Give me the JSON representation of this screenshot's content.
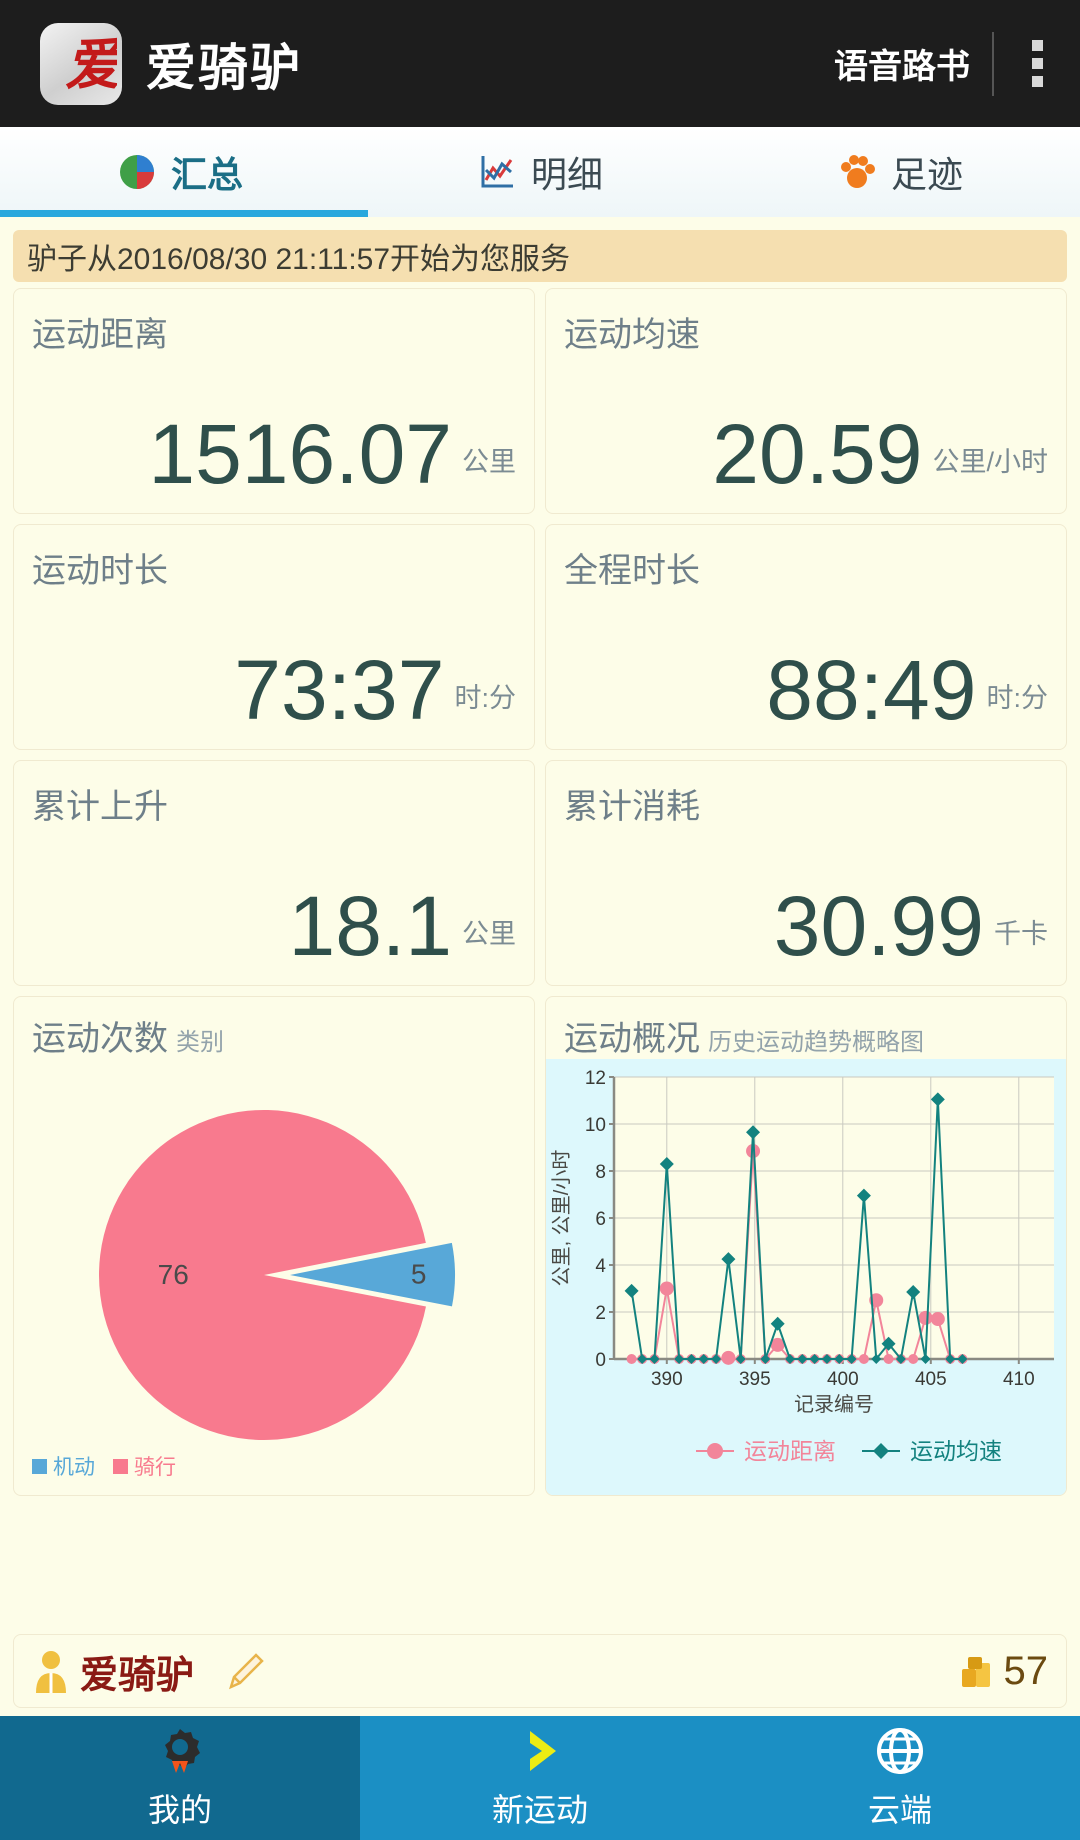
{
  "appbar": {
    "logo_icon": "app-logo-icon",
    "title": "爱骑驴",
    "voice_button": "语音路书",
    "overflow_icon": "overflow-menu-icon"
  },
  "tabs": [
    {
      "label": "汇总",
      "icon": "pie-chart-icon",
      "active": true
    },
    {
      "label": "明细",
      "icon": "line-chart-icon",
      "active": false
    },
    {
      "label": "足迹",
      "icon": "paw-print-icon",
      "active": false
    }
  ],
  "banner": {
    "text": "驴子从2016/08/30 21:11:57开始为您服务"
  },
  "stats": [
    {
      "title": "运动距离",
      "value": "1516.07",
      "unit": "公里"
    },
    {
      "title": "运动均速",
      "value": "20.59",
      "unit": "公里/小时"
    },
    {
      "title": "运动时长",
      "value": "73:37",
      "unit": "时:分"
    },
    {
      "title": "全程时长",
      "value": "88:49",
      "unit": "时:分"
    },
    {
      "title": "累计上升",
      "value": "18.1",
      "unit": "公里"
    },
    {
      "title": "累计消耗",
      "value": "30.99",
      "unit": "千卡"
    }
  ],
  "pie_card": {
    "title": "运动次数",
    "subtitle": "类别"
  },
  "line_card": {
    "title": "运动概况",
    "subtitle": "历史运动趋势概略图"
  },
  "userbar": {
    "avatar_icon": "user-avatar-icon",
    "name": "爱骑驴",
    "edit_icon": "pencil-edit-icon",
    "coin_icon": "coin-stack-icon",
    "coin_count": "57"
  },
  "bottomnav": [
    {
      "label": "我的",
      "icon": "gear-rocket-icon",
      "active": true
    },
    {
      "label": "新运动",
      "icon": "chevron-right-icon",
      "active": false
    },
    {
      "label": "云端",
      "icon": "globe-icon",
      "active": false
    }
  ],
  "colors": {
    "accent": "#29a8dd",
    "nav": "#1b8fc4",
    "nav_active": "#11698f",
    "card_bg": "#fdfde8",
    "banner_bg": "#f5dfb0",
    "pie_pink": "#f87a8e",
    "pie_blue": "#58a8d8",
    "line_pink": "#f2859a",
    "line_teal": "#13827f",
    "chart_bg": "#ddf8fc",
    "value_text": "#2f4f4b",
    "title_text": "#6e7f89"
  },
  "chart_data": [
    {
      "type": "pie",
      "title": "运动次数",
      "subtitle": "类别",
      "labels": [
        "骑行",
        "机动"
      ],
      "values": [
        76,
        5
      ],
      "colors": [
        "#f87a8e",
        "#58a8d8"
      ],
      "exploded": [
        "机动"
      ],
      "legend_position": "bottom-left",
      "data_labels": [
        "76",
        "5"
      ]
    },
    {
      "type": "line",
      "title": "运动概况",
      "subtitle": "历史运动趋势概略图",
      "xlabel": "记录编号",
      "ylabel": "公里, 公里/小时",
      "xlim": [
        387,
        412
      ],
      "ylim": [
        0,
        12
      ],
      "xticks": [
        390,
        395,
        400,
        405,
        410
      ],
      "yticks": [
        0,
        2,
        4,
        6,
        8,
        10,
        12
      ],
      "grid": true,
      "legend_position": "bottom-center",
      "x": [
        388,
        388.6,
        389.3,
        390,
        390.7,
        391.4,
        392.1,
        392.8,
        393.5,
        394.2,
        394.9,
        395.6,
        396.3,
        397,
        397.7,
        398.4,
        399.1,
        399.8,
        400.5,
        401.2,
        401.9,
        402.6,
        403.3,
        404,
        404.7,
        405.4,
        406.1,
        406.8
      ],
      "series": [
        {
          "name": "运动距离",
          "color": "#f2859a",
          "marker": "circle",
          "values": [
            0,
            0,
            0,
            3.0,
            0,
            0,
            0,
            0,
            0.05,
            0,
            8.85,
            0,
            0.6,
            0,
            0,
            0,
            0,
            0,
            0,
            0,
            2.5,
            0,
            0,
            0,
            1.75,
            1.7,
            0,
            0
          ]
        },
        {
          "name": "运动均速",
          "color": "#13827f",
          "marker": "diamond",
          "values": [
            2.9,
            0,
            0,
            8.3,
            0,
            0,
            0,
            0,
            4.25,
            0,
            9.65,
            0,
            1.5,
            0,
            0,
            0,
            0,
            0,
            0,
            6.95,
            0,
            0.65,
            0,
            2.85,
            0,
            11.05,
            0,
            0
          ]
        }
      ]
    }
  ]
}
